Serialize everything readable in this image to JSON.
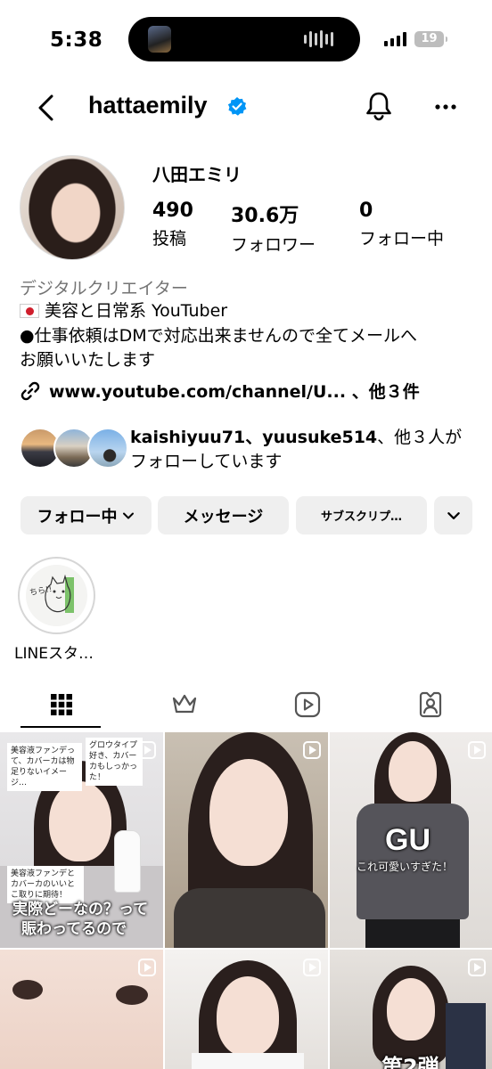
{
  "status": {
    "time": "5:38",
    "battery": "19"
  },
  "header": {
    "username": "hattaemily"
  },
  "profile": {
    "display_name": "八田エミリ",
    "stats": [
      {
        "value": "490",
        "label": "投稿"
      },
      {
        "value": "30.6万",
        "label": "フォロワー"
      },
      {
        "value": "0",
        "label": "フォロー中"
      }
    ],
    "category": "デジタルクリエイター",
    "bio_lines": [
      "美容と日常系 YouTuber",
      "●仕事依頼はDMで対応出来ませんので全てメールへ",
      "お願いいたします"
    ],
    "link": "www.youtube.com/channel/U... 、他３件",
    "followed_by_line1_names": "kaishiyuu71、yuusuke514",
    "followed_by_line1_rest": "、他３人が",
    "followed_by_line2": "フォローしています"
  },
  "buttons": {
    "following": "フォロー中",
    "message": "メッセージ",
    "subscribe": "サブスクリプ…"
  },
  "highlight": {
    "label": "LINEスタ…",
    "sticker_text": "ちら!!"
  },
  "tabs": [
    "grid-icon",
    "crown-icon",
    "reels-icon",
    "tagged-icon"
  ],
  "posts": {
    "p1_cap1": "美容液ファンデって、カバーカは物足りないイメージ…",
    "p1_cap2": "グロウタイプ好き、カバーカもしっかった！",
    "p1_cap3": "美容液ファンデとカバーカのいいとこ取りに期待！",
    "p1_big1": "実際どーなの？って",
    "p1_big2": "賑わってるので",
    "p3_brand": "GU",
    "p3_sub": "これ可愛いすぎた！",
    "p6_big": "第2弾"
  }
}
